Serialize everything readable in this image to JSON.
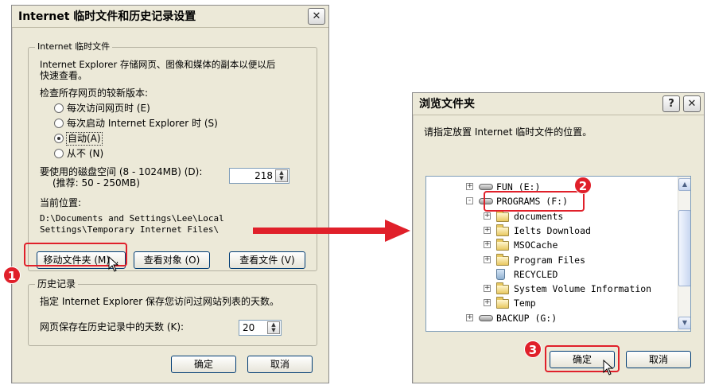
{
  "left_dialog": {
    "title": "Internet 临时文件和历史记录设置",
    "close_glyph": "✕",
    "temp_group": {
      "legend": "Internet 临时文件",
      "desc_line1": "Internet Explorer 存储网页、图像和媒体的副本以便以后",
      "desc_line2": "快速查看。",
      "check_label": "检查所存网页的较新版本:",
      "radio_options": [
        {
          "label": "每次访问网页时 (E)",
          "selected": false
        },
        {
          "label": "每次启动 Internet Explorer 时 (S)",
          "selected": false
        },
        {
          "label": "自动(A)",
          "selected": true
        },
        {
          "label": "从不 (N)",
          "selected": false
        }
      ],
      "disk_label_line1": "要使用的磁盘空间 (8 - 1024MB) (D):",
      "disk_label_line2": "(推荐: 50 - 250MB)",
      "disk_value": "218",
      "location_label": "当前位置:",
      "location_line1": "D:\\Documents and Settings\\Lee\\Local",
      "location_line2": "Settings\\Temporary Internet Files\\",
      "move_button": "移动文件夹 (M)...",
      "view_objects_button": "查看对象 (O)",
      "view_files_button": "查看文件 (V)"
    },
    "history_group": {
      "legend": "历史记录",
      "desc": "指定 Internet Explorer 保存您访问过网站列表的天数。",
      "days_label": "网页保存在历史记录中的天数 (K):",
      "days_value": "20"
    },
    "ok_button": "确定",
    "cancel_button": "取消"
  },
  "right_dialog": {
    "title": "浏览文件夹",
    "help_glyph": "?",
    "close_glyph": "✕",
    "prompt": "请指定放置 Internet 临时文件的位置。",
    "tree_items": [
      {
        "label": "FUN (E:)",
        "type": "drive",
        "expander": "+"
      },
      {
        "label": "PROGRAMS (F:)",
        "type": "drive",
        "expander": "-"
      },
      {
        "label": "documents",
        "type": "folder",
        "expander": "+"
      },
      {
        "label": "Ielts Download",
        "type": "folder",
        "expander": "+"
      },
      {
        "label": "MSOCache",
        "type": "folder",
        "expander": "+"
      },
      {
        "label": "Program Files",
        "type": "folder",
        "expander": "+"
      },
      {
        "label": "RECYCLED",
        "type": "recycle",
        "expander": ""
      },
      {
        "label": "System Volume Information",
        "type": "folder",
        "expander": "+"
      },
      {
        "label": "Temp",
        "type": "folder",
        "expander": "+"
      },
      {
        "label": "BACKUP (G:)",
        "type": "drive",
        "expander": "+"
      }
    ],
    "ok_button": "确定",
    "cancel_button": "取消"
  },
  "callouts": [
    "1",
    "2",
    "3"
  ],
  "colors": {
    "callout_red": "#e0202a",
    "dialog_bg": "#ece9d8",
    "field_border": "#7f9db9"
  }
}
